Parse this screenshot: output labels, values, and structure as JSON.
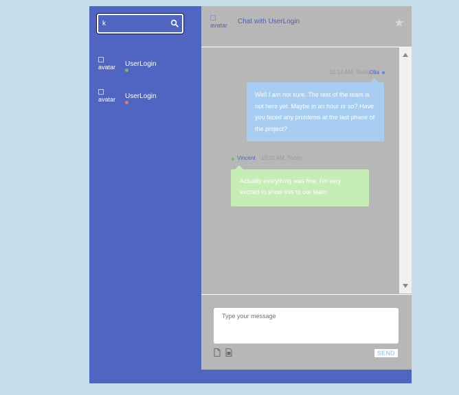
{
  "search": {
    "value": "k",
    "placeholder": ""
  },
  "people": [
    {
      "avatar_alt": "avatar",
      "name": "UserLogin",
      "status": "online",
      "status_color": "#6cc069"
    },
    {
      "avatar_alt": "avatar",
      "name": "UserLogin",
      "status": "offline",
      "status_color": "#e07a7a"
    }
  ],
  "chat": {
    "avatar_alt": "avatar",
    "title": "Chat with UserLogin",
    "messages": [
      {
        "time": "10:14 AM, Today",
        "author": "Olia",
        "text": "Well I am not sure. The rest of the team is not here yet. Maybe in an hour or so? Have you faced any problems at the last phase of the project?"
      },
      {
        "time": "10:20 AM, Today",
        "author": "Vincent",
        "text": "Actually everything was fine. I'm very excited to show this to our team."
      }
    ]
  },
  "compose": {
    "placeholder": "Type your message",
    "send_label": "SEND"
  },
  "colors": {
    "page_bg": "#c5dde8",
    "sidebar_bg": "#5064c2",
    "chat_bg": "#b7b7b7",
    "my_bubble": "#a7cdf3",
    "their_bubble": "#c6eeb4",
    "accent_text": "#4a5fc0"
  },
  "icons": [
    "search-icon",
    "star-icon",
    "file-icon",
    "image-icon",
    "scroll-up-arrow",
    "scroll-down-arrow"
  ]
}
